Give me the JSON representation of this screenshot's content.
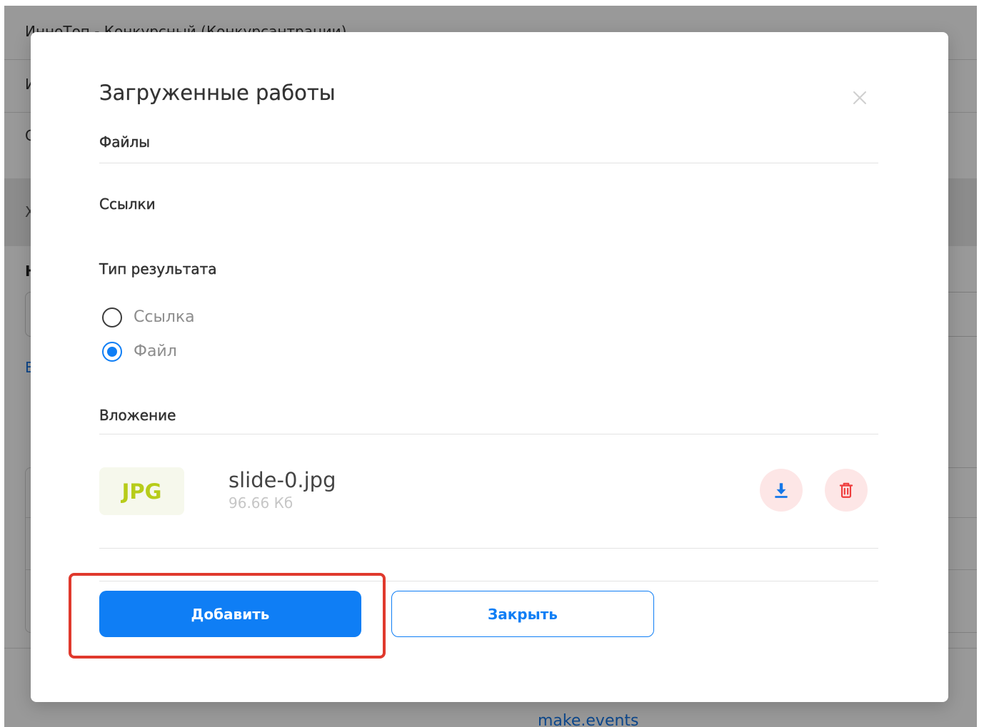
{
  "background": {
    "header_text": "ИнноТоп - Конкурсный (Конкурсантрации)",
    "row_initials": [
      "И",
      "С",
      "Х",
      "Н",
      "Е"
    ],
    "footer_link": "make.events"
  },
  "modal": {
    "title": "Загруженные работы",
    "close_icon": "close-icon",
    "sections": {
      "files_label": "Файлы",
      "links_label": "Ссылки",
      "attachment_label": "Вложение"
    },
    "result_type": {
      "label": "Тип результата",
      "options": [
        {
          "label": "Ссылка",
          "selected": false
        },
        {
          "label": "Файл",
          "selected": true
        }
      ]
    },
    "attachment": {
      "badge": "JPG",
      "file_name": "slide-0.jpg",
      "file_size": "96.66 Кб",
      "download_icon": "download-icon",
      "delete_icon": "trash-icon"
    },
    "buttons": {
      "add_label": "Добавить",
      "close_label": "Закрыть"
    }
  },
  "colors": {
    "accent": "#0f7ef5",
    "danger": "#ef3d3d",
    "jpg_badge_text": "#b7cc1a",
    "jpg_badge_background": "#f6f8ec",
    "icon_button_background": "#fde6e6",
    "annotation_highlight": "#e0392d",
    "link": "#1677e8"
  }
}
